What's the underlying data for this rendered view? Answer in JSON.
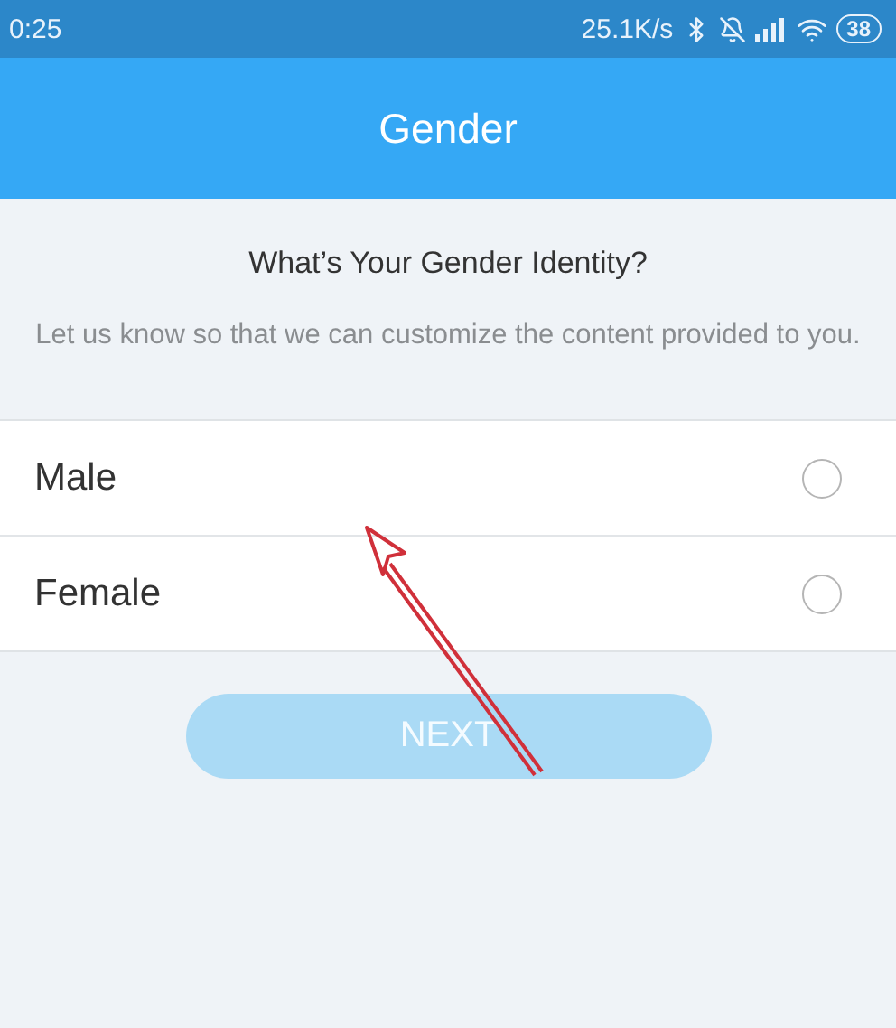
{
  "status_bar": {
    "time": "0:25",
    "speed": "25.1K/s",
    "battery": "38"
  },
  "header": {
    "title": "Gender"
  },
  "question": "What’s Your Gender Identity?",
  "description": "Let us know so that we can customize the content provided to you.",
  "options": [
    {
      "label": "Male",
      "selected": false
    },
    {
      "label": "Female",
      "selected": false
    }
  ],
  "next_button": {
    "label": "NEXT",
    "disabled": true
  }
}
